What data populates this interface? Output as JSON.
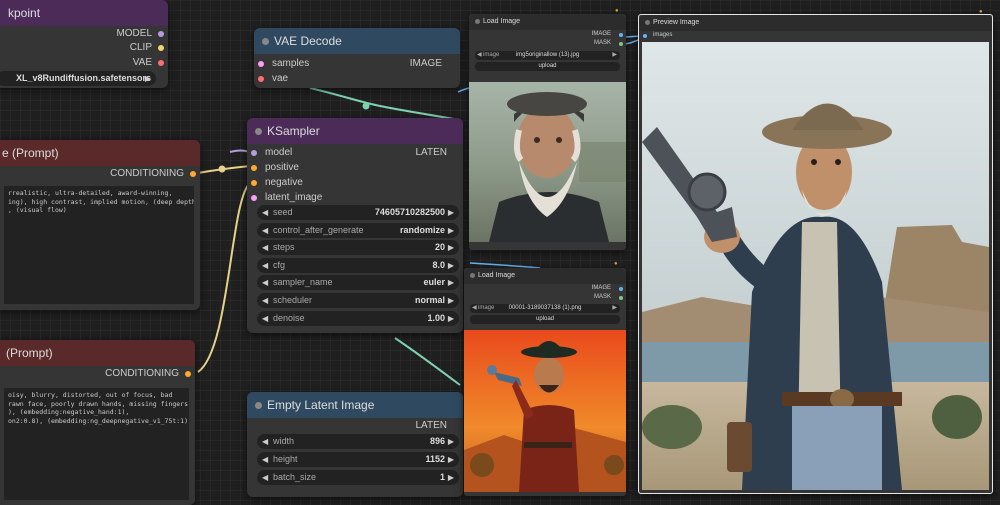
{
  "checkpoint_node": {
    "title": "kpoint",
    "outputs": [
      "MODEL",
      "CLIP",
      "VAE"
    ],
    "model_value": "XL_v8Rundiffusion.safetensors"
  },
  "vae_decode": {
    "title": "VAE Decode",
    "inputs": [
      "samples",
      "vae"
    ],
    "output": "IMAGE"
  },
  "ksampler": {
    "title": "KSampler",
    "inputs": [
      "model",
      "positive",
      "negative",
      "latent_image"
    ],
    "output": "LATEN",
    "widgets": [
      {
        "label": "seed",
        "value": "74605710282500"
      },
      {
        "label": "control_after_generate",
        "value": "randomize"
      },
      {
        "label": "steps",
        "value": "20"
      },
      {
        "label": "cfg",
        "value": "8.0"
      },
      {
        "label": "sampler_name",
        "value": "euler"
      },
      {
        "label": "scheduler",
        "value": "normal"
      },
      {
        "label": "denoise",
        "value": "1.00"
      }
    ]
  },
  "positive_prompt": {
    "title": "e (Prompt)",
    "output": "CONDITIONING",
    "text": "rrealistic, ultra-detailed, award-winning,\ning), high contrast, implied motion, (deep depth\n, (visual flow)"
  },
  "negative_prompt": {
    "title": "(Prompt)",
    "output": "CONDITIONING",
    "text": "oisy, blurry, distorted, out of focus, bad\nrawn face, poorly drawn hands, missing fingers,\n), (embedding:negative_hand:1),\non2:0.8), (embedding:ng_deepnegative_v1_75t:1),"
  },
  "empty_latent": {
    "title": "Empty Latent Image",
    "output": "LATEN",
    "widgets": [
      {
        "label": "width",
        "value": "896"
      },
      {
        "label": "height",
        "value": "1152"
      },
      {
        "label": "batch_size",
        "value": "1"
      }
    ]
  },
  "load_image_1": {
    "title": "Load Image",
    "outputs": [
      "IMAGE",
      "MASK"
    ],
    "image_label": "image",
    "image_value": "img5originallow (13).jpg",
    "upload_label": "upload"
  },
  "load_image_2": {
    "title": "Load Image",
    "outputs": [
      "IMAGE",
      "MASK"
    ],
    "image_label": "image",
    "image_value": "00001-3189037138 (1).png",
    "upload_label": "upload"
  },
  "preview_image": {
    "title": "Preview Image",
    "input": "images"
  },
  "colors": {
    "model": "#b39ddb",
    "clip": "#f2d86b",
    "vae": "#ff6e6e",
    "conditioning": "#ffa931",
    "latent": "#ff9cf9",
    "image": "#64b5f6",
    "mask": "#81c784",
    "wire_green": "#7fd1b0",
    "wire_yellow": "#e8d28a"
  }
}
